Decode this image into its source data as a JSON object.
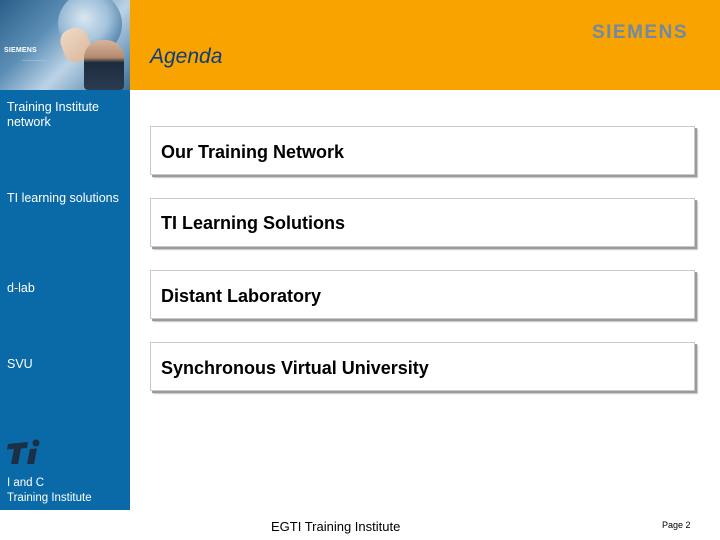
{
  "header": {
    "title": "Agenda",
    "logo_text": "SIEMENS",
    "photo_brand": "SIEMENS",
    "accent_color": "#f8a300"
  },
  "sidebar": {
    "background_color": "#0a6aa7",
    "items": [
      {
        "label": "Training Institute network"
      },
      {
        "label": "TI learning solutions"
      },
      {
        "label": "d-lab"
      },
      {
        "label": "SVU"
      }
    ],
    "logo_icon": "ti-logo-icon",
    "footer_line1": "I and C",
    "footer_line2": "Training Institute"
  },
  "agenda": {
    "items": [
      {
        "label": "Our Training Network"
      },
      {
        "label": "TI Learning Solutions"
      },
      {
        "label": "Distant Laboratory"
      },
      {
        "label": "Synchronous Virtual University"
      }
    ]
  },
  "footer": {
    "text": "EGTI Training Institute",
    "page": "Page 2"
  }
}
